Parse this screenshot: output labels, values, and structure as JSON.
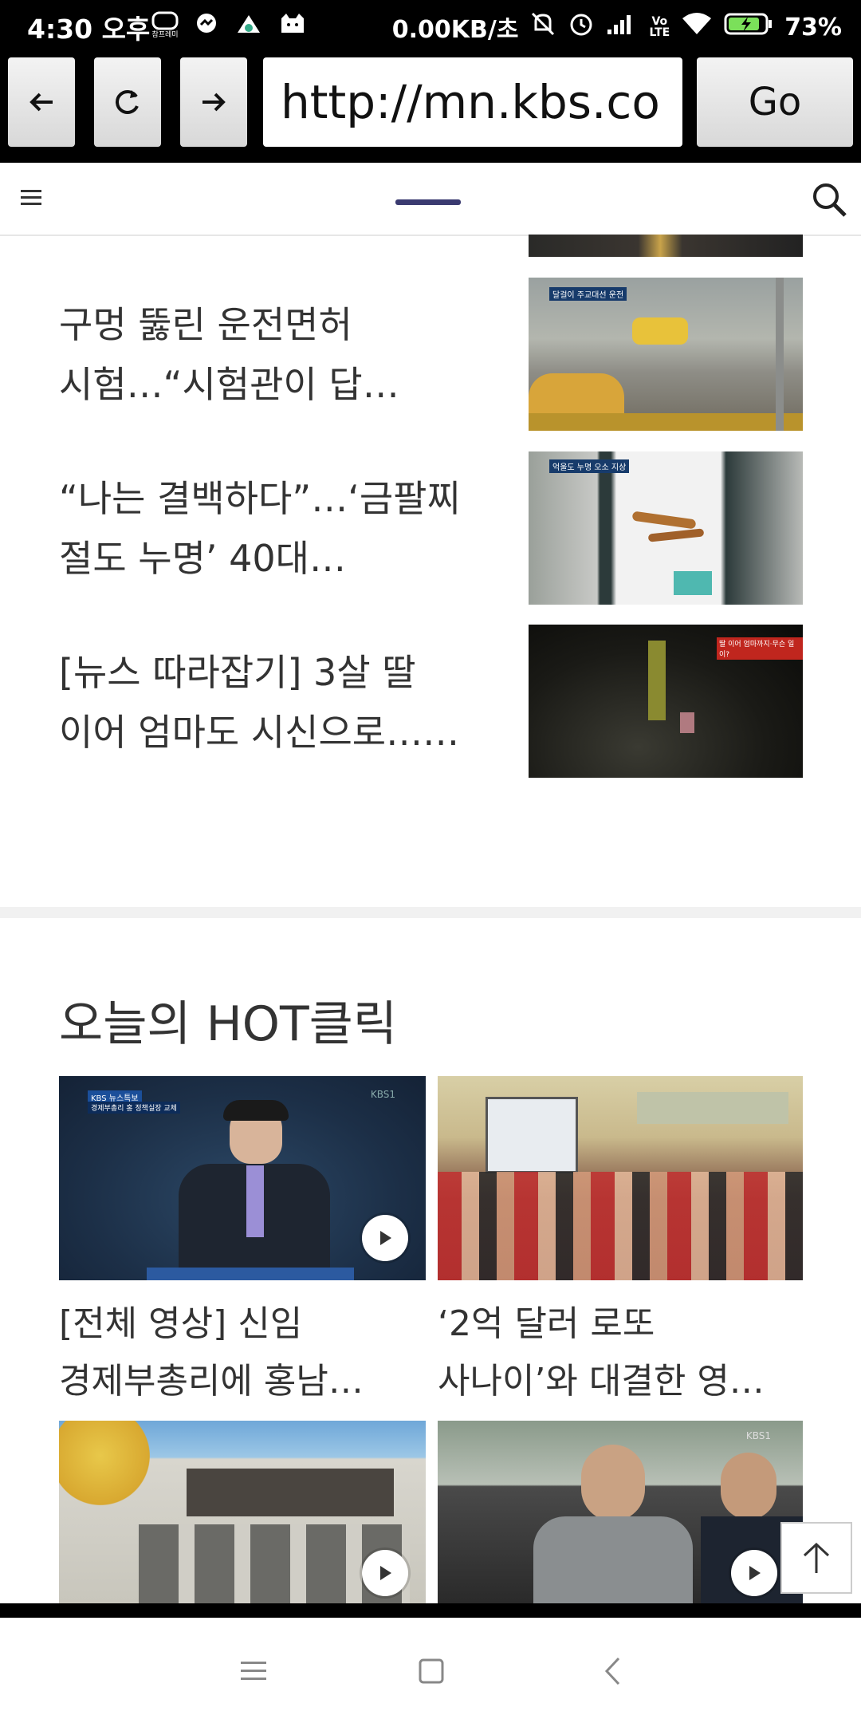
{
  "status_bar": {
    "time": "4:30 오후",
    "net_speed": "0.00KB/초",
    "battery": "73%",
    "notif_label": "참프레미"
  },
  "browser": {
    "url": "http://mn.kbs.co",
    "go_label": "Go"
  },
  "articles": [
    {
      "line1": "구멍 뚫린 운전면허",
      "line2": "시험…“시험관이 답…",
      "thumb_caption": "달걸이 주교대선 운전"
    },
    {
      "line1": "“나는 결백하다”…‘금팔찌",
      "line2": "절도 누명’ 40대…",
      "thumb_caption": "억울도 누명 오소 지상"
    },
    {
      "line1": "[뉴스 따라잡기] 3살 딸",
      "line2": "이어 엄마도 시신으로……",
      "thumb_caption": "딸 이어 엄마까지·무슨 일이?"
    }
  ],
  "hot": {
    "title": "오늘의 HOT클릭",
    "cards": [
      {
        "line1": "[전체 영상] 신임",
        "line2": "경제부총리에 홍남…",
        "tag": "KBS 뉴스특보",
        "caption": "경제부총리 홍 정책실장 교체",
        "watermark": "KBS1"
      },
      {
        "line1": "‘2억 달러 로또",
        "line2": "사나이’와 대결한 영…"
      },
      {},
      {
        "watermark": "KBS1"
      }
    ]
  }
}
